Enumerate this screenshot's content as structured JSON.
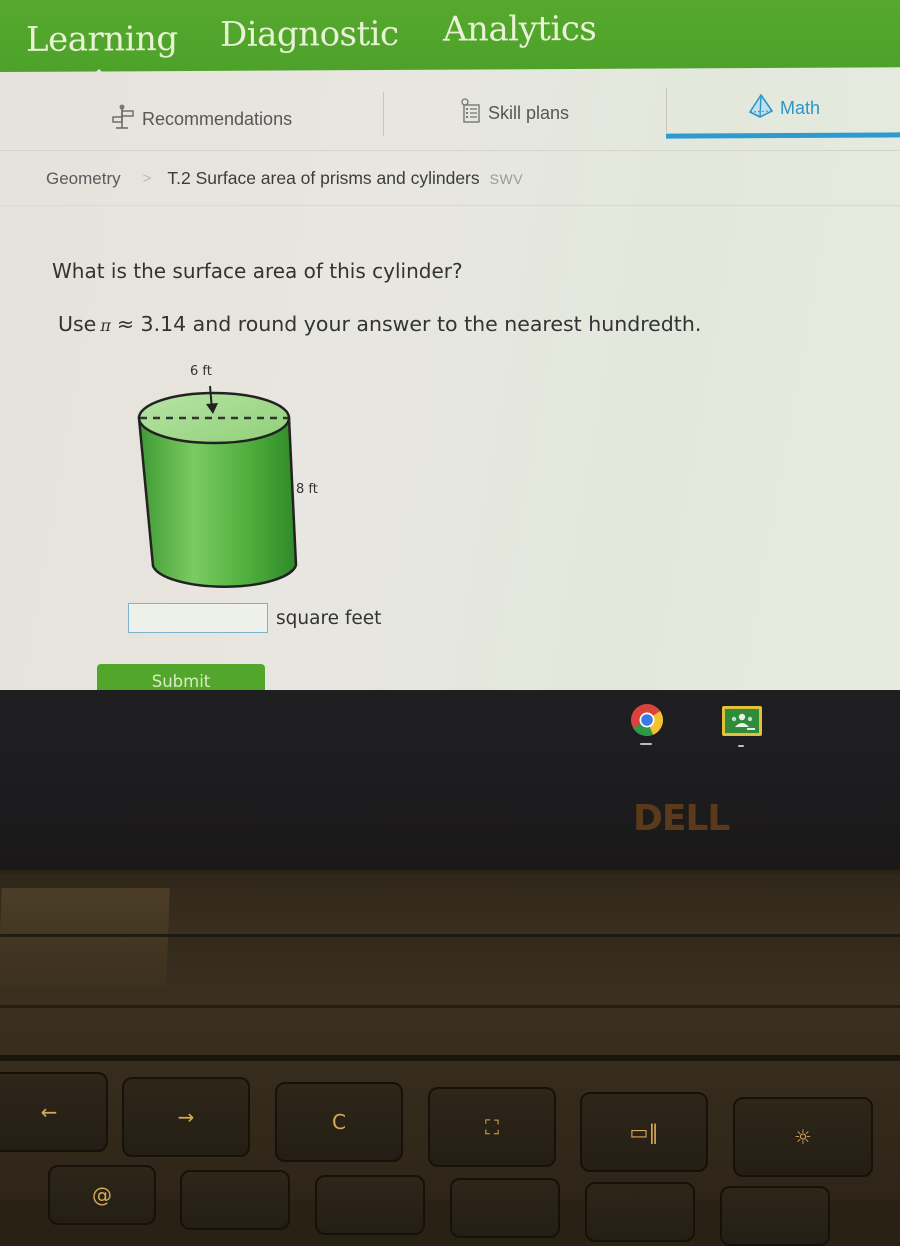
{
  "top_nav": {
    "tabs": [
      {
        "label": "Learning",
        "active": true
      },
      {
        "label": "Diagnostic",
        "active": false
      },
      {
        "label": "Analytics",
        "active": false
      }
    ],
    "background_color": "#52a62b"
  },
  "sub_nav": {
    "items": [
      {
        "label": "Recommendations",
        "icon": "signpost-icon",
        "active": false
      },
      {
        "label": "Skill plans",
        "icon": "checklist-icon",
        "active": false
      },
      {
        "label": "Math",
        "icon": "pyramid-icon",
        "active": true
      }
    ],
    "active_color": "#2d9ad0"
  },
  "breadcrumb": {
    "subject": "Geometry",
    "separator": ">",
    "skill": "T.2 Surface area of prisms and cylinders",
    "skill_code": "SWV"
  },
  "problem": {
    "question": "What is the surface area of this cylinder?",
    "instruction_prefix": "Use",
    "pi_symbol": "π",
    "instruction_suffix": "≈ 3.14 and round your answer to the nearest hundredth.",
    "figure": {
      "shape": "cylinder",
      "diameter_label": "6 ft",
      "height_label": "8 ft",
      "fill_color": "#5dbb4a"
    },
    "answer": {
      "value": "",
      "placeholder": "",
      "unit": "square feet"
    },
    "submit_label": "Submit"
  },
  "shelf": {
    "apps": [
      {
        "name": "Chrome",
        "icon": "chrome-icon"
      },
      {
        "name": "Google Classroom",
        "icon": "classroom-icon"
      }
    ]
  },
  "device": {
    "brand": "DELL"
  },
  "keyboard": {
    "function_keys": [
      {
        "symbol": "←",
        "name": "back"
      },
      {
        "symbol": "→",
        "name": "forward"
      },
      {
        "symbol": "C",
        "name": "refresh"
      },
      {
        "symbol": "⛶",
        "name": "fullscreen"
      },
      {
        "symbol": "▭‖",
        "name": "overview"
      },
      {
        "symbol": "☼",
        "name": "brightness-down"
      }
    ],
    "row2_keys": [
      "@"
    ]
  }
}
